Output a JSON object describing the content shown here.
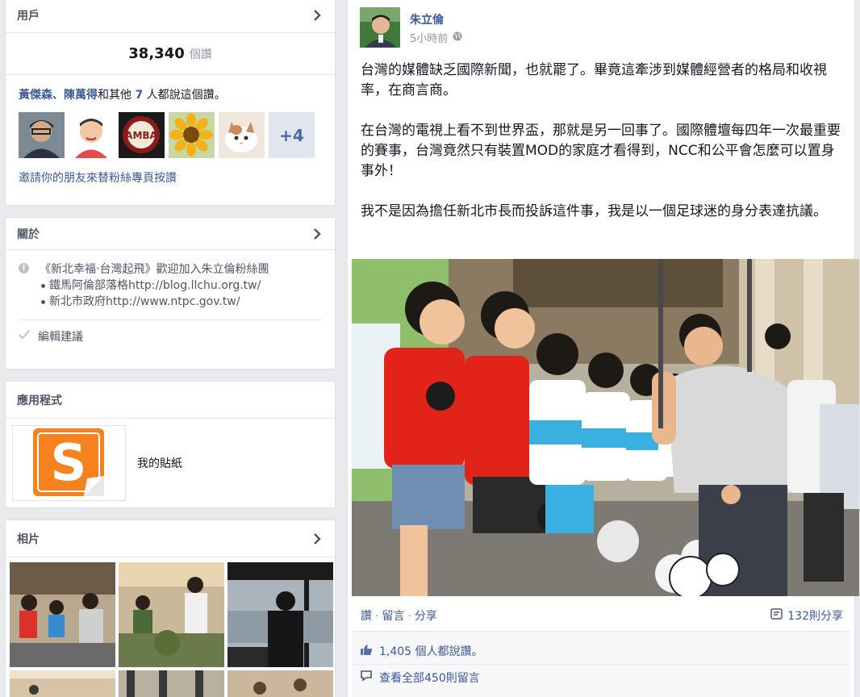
{
  "colors": {
    "link": "#3b5998",
    "muted": "#9197a3",
    "text": "#141823",
    "page_bg": "#e9eaed"
  },
  "likes_card": {
    "title": "用戶",
    "count": "38,340",
    "count_unit": "個讚",
    "friend1": "黃傑森",
    "separator": "、",
    "friend2": "陳萬得",
    "and_others": "和其他",
    "others_count": "7",
    "suffix": "人都說這個讚。",
    "more_badge": "+4",
    "invite": "邀請你的朋友來替粉絲專頁按讚"
  },
  "about_card": {
    "title": "關於",
    "line1": "《新北幸福‧台灣起飛》歡迎加入朱立倫粉絲團",
    "line2": "鐵馬阿倫部落格http://blog.llchu.org.tw/",
    "line3": "新北市政府http://www.ntpc.gov.tw/",
    "edit": "編輯建議"
  },
  "apps_card": {
    "title": "應用程式",
    "app_name": "我的貼紙"
  },
  "photos_card": {
    "title": "相片"
  },
  "post": {
    "author": "朱立倫",
    "time": "5小時前",
    "para1": "台灣的媒體缺乏國際新聞，也就罷了。畢竟這牽涉到媒體經營者的格局和收視率，在商言商。",
    "para2": "在台灣的電視上看不到世界盃，那就是另一回事了。國際體壇每四年一次最重要的賽事，台灣竟然只有裝置MOD的家庭才看得到，NCC和公平會怎麼可以置身事外！",
    "para3": "我不是因為擔任新北市長而投訴這件事，我是以一個足球迷的身分表達抗議。",
    "action_like": "讚",
    "action_comment": "留言",
    "action_share": "分享",
    "dot": "·",
    "shares": "132則分享",
    "likes_summary": "1,405 個人都說讚。",
    "comments_summary": "查看全部450則留言"
  }
}
